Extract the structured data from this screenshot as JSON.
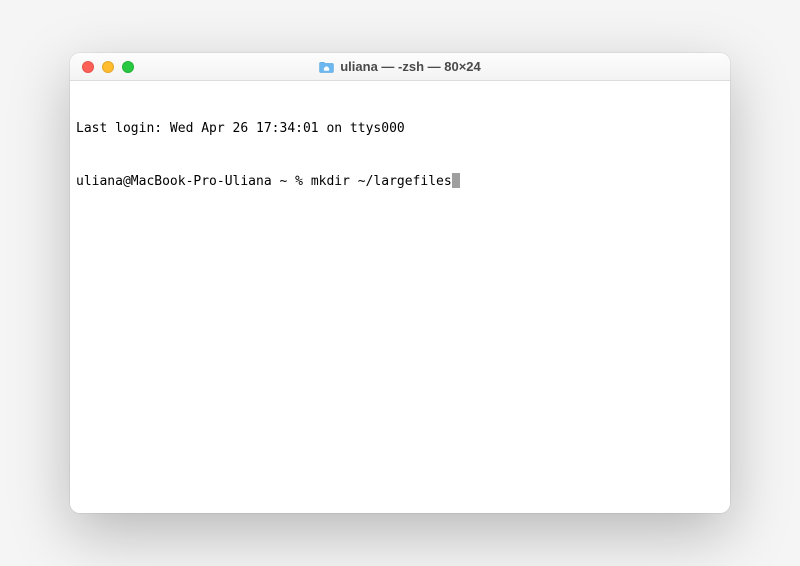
{
  "window": {
    "title": "uliana — -zsh — 80×24"
  },
  "terminal": {
    "last_login_line": "Last login: Wed Apr 26 17:34:01 on ttys000",
    "prompt": "uliana@MacBook-Pro-Uliana ~ % ",
    "command": "mkdir ~/largefiles"
  }
}
